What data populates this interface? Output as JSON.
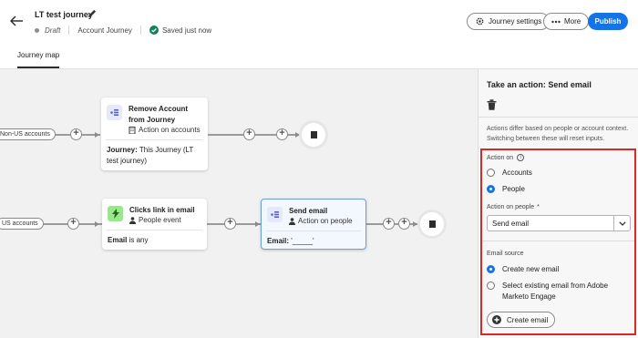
{
  "header": {
    "title": "LT test journey",
    "status": "Draft",
    "journey_type": "Account Journey",
    "saved": "Saved just now",
    "settings_label": "Journey settings",
    "more_label": "More",
    "publish_label": "Publish"
  },
  "tabs": [
    {
      "label": "Journey map"
    }
  ],
  "canvas": {
    "row1": {
      "entry_label": "Non-US accounts",
      "node": {
        "title": "Remove Account from Journey",
        "subtitle": "Action on accounts",
        "detail_key": "Journey:",
        "detail_value": "This Journey (LT test journey)"
      }
    },
    "row2": {
      "entry_label": "US accounts",
      "event_node": {
        "title": "Clicks link in email",
        "subtitle": "People event",
        "detail_key": "Email",
        "detail_value": "is any"
      },
      "action_node": {
        "title": "Send email",
        "subtitle": "Action on people",
        "detail_key": "Email:",
        "detail_value": "'_____'"
      }
    }
  },
  "panel": {
    "title": "Take an action: Send email",
    "description": "Actions differ based on people or account context. Switching between these will reset inputs.",
    "action_on": {
      "label": "Action on",
      "options": [
        {
          "label": "Accounts",
          "selected": false
        },
        {
          "label": "People",
          "selected": true
        }
      ]
    },
    "action_on_people": {
      "label": "Action on people",
      "required_mark": "*",
      "value": "Send email"
    },
    "email_source": {
      "label": "Email source",
      "options": [
        {
          "label": "Create new email",
          "selected": true
        },
        {
          "label": "Select existing email from Adobe Marketo Engage",
          "selected": false
        }
      ]
    },
    "create_button_label": "Create email"
  },
  "colors": {
    "accent": "#1473e6",
    "highlight_box": "#d62b25",
    "event_icon_bg": "#9be58f",
    "action_icon_bg": "#e6e8fb",
    "selected_node_border": "#6e9ed8"
  },
  "icons": [
    "back-arrow-icon",
    "pencil-icon",
    "checkmark-circle-icon",
    "gear-icon",
    "ellipsis-icon",
    "trash-icon",
    "info-icon",
    "chevron-down-icon",
    "plus-circle-icon",
    "action-icon",
    "lightning-icon",
    "building-icon",
    "person-icon",
    "stop-icon"
  ]
}
